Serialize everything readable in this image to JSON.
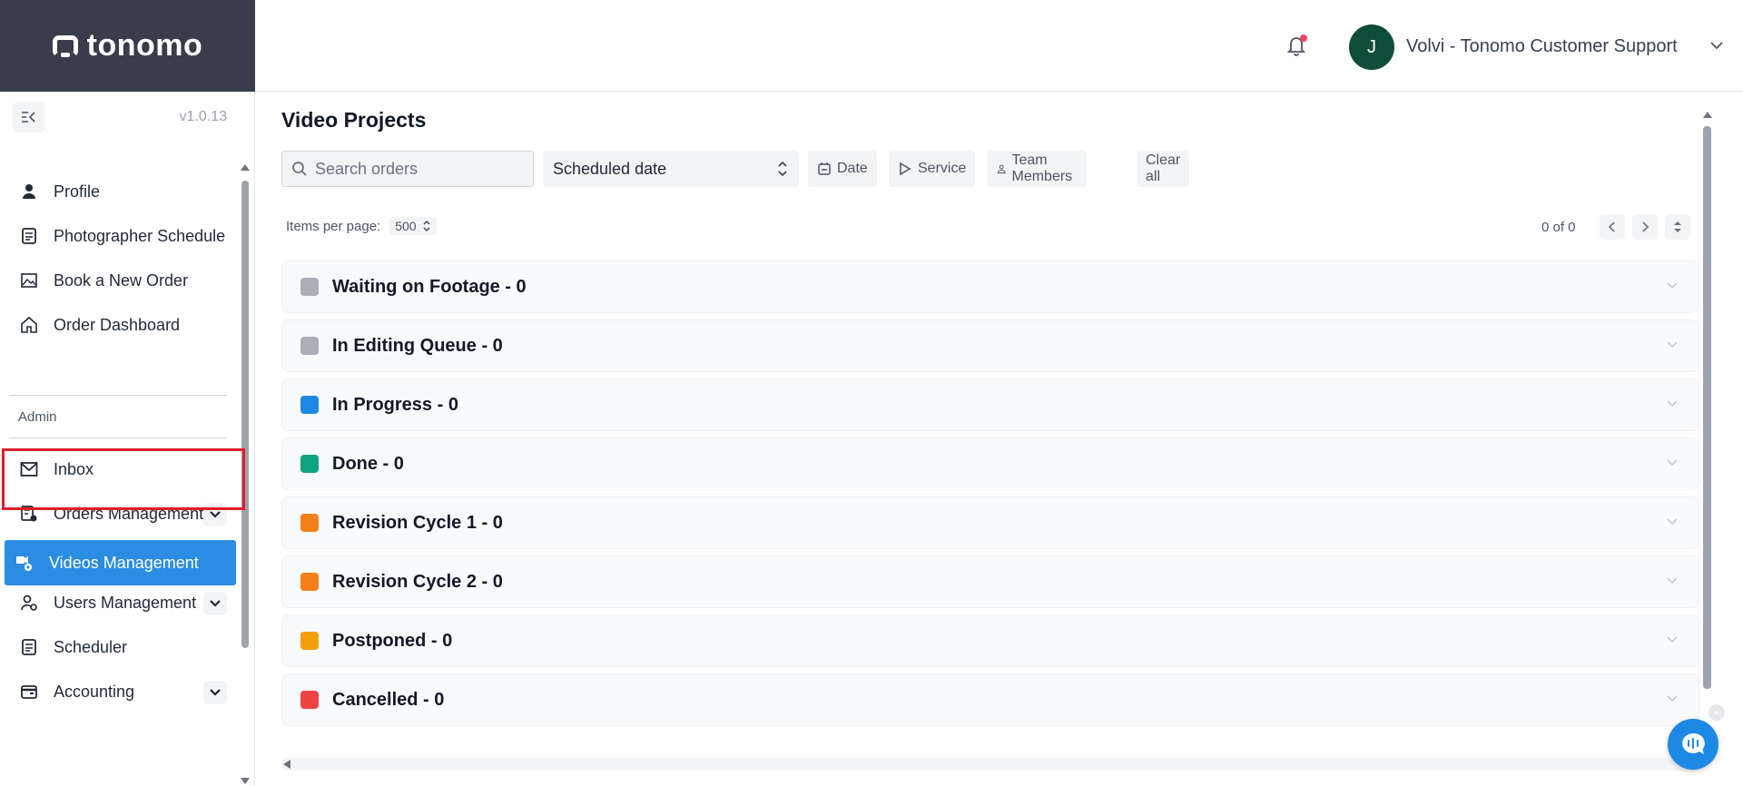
{
  "app": {
    "logo_text": "tonomo",
    "version": "v1.0.13"
  },
  "header": {
    "user_initial": "J",
    "user_name": "Volvi - Tonomo Customer Support"
  },
  "sidebar": {
    "items": [
      {
        "label": "Profile",
        "icon": "user-icon"
      },
      {
        "label": "Photographer Schedule",
        "icon": "schedule-icon"
      },
      {
        "label": "Book a New Order",
        "icon": "image-icon"
      },
      {
        "label": "Order Dashboard",
        "icon": "home-icon"
      }
    ],
    "section_label": "Admin",
    "admin_items": [
      {
        "label": "Inbox",
        "icon": "mail-icon"
      },
      {
        "label": "Orders Management",
        "icon": "orders-icon",
        "expandable": true
      },
      {
        "label": "Videos Management",
        "icon": "video-icon",
        "active": true
      },
      {
        "label": "Users Management",
        "icon": "users-gear-icon",
        "expandable": true
      },
      {
        "label": "Scheduler",
        "icon": "calendar-icon"
      },
      {
        "label": "Accounting",
        "icon": "wallet-icon",
        "expandable": true
      }
    ]
  },
  "main": {
    "title": "Video Projects",
    "search_placeholder": "Search orders",
    "sort_select": "Scheduled date",
    "filters": {
      "date": "Date",
      "service": "Service",
      "team": "Team Members",
      "clear": "Clear all"
    },
    "items_per_page_label": "Items per page:",
    "items_per_page_value": "500",
    "pager_text": "0 of 0",
    "groups": [
      {
        "label": "Waiting on Footage - 0",
        "color": "#a9b0b8"
      },
      {
        "label": "In Editing Queue - 0",
        "color": "#a9b0b8"
      },
      {
        "label": "In Progress - 0",
        "color": "#1e88e5"
      },
      {
        "label": "Done - 0",
        "color": "#10a37f"
      },
      {
        "label": "Revision Cycle 1 - 0",
        "color": "#f57f17"
      },
      {
        "label": "Revision Cycle 2 - 0",
        "color": "#f57f17"
      },
      {
        "label": "Postponed - 0",
        "color": "#f59e0b"
      },
      {
        "label": "Cancelled - 0",
        "color": "#ef4444"
      }
    ]
  }
}
